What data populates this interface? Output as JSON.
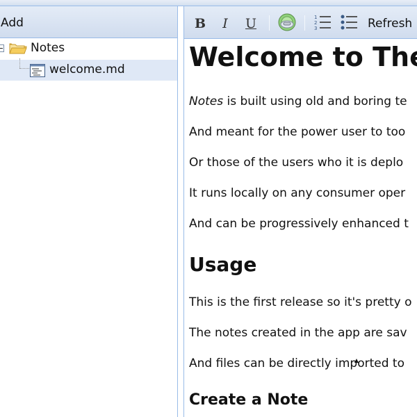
{
  "left": {
    "add_label": "Add",
    "tree": {
      "root": {
        "label": "Notes",
        "icon": "folder-icon"
      },
      "child": {
        "label": "welcome.md",
        "icon": "document-icon"
      }
    }
  },
  "toolbar": {
    "bold": "B",
    "italic": "I",
    "underline": "U",
    "refresh_label": "Refresh"
  },
  "editor": {
    "title": "Welcome to The",
    "intro_em": "Notes",
    "intro_rest": " is built using old and boring te",
    "line2": "And meant for the power user to too",
    "line3": "Or those of the users who it is deplo",
    "line4": "It runs locally on any consumer oper",
    "line5": "And can be progressively enhanced t",
    "usage_heading": "Usage",
    "usage1": "This is the first release so it's pretty o",
    "usage2": "The notes created in the app are sav",
    "usage3": "And files can be directly imported to",
    "create_heading": "Create a Note"
  },
  "colors": {
    "panel_border": "#99bbe8",
    "toolbar_bg": "#d0dcee",
    "selected_row": "#dfe8f6",
    "folder": "#f4d27a"
  }
}
